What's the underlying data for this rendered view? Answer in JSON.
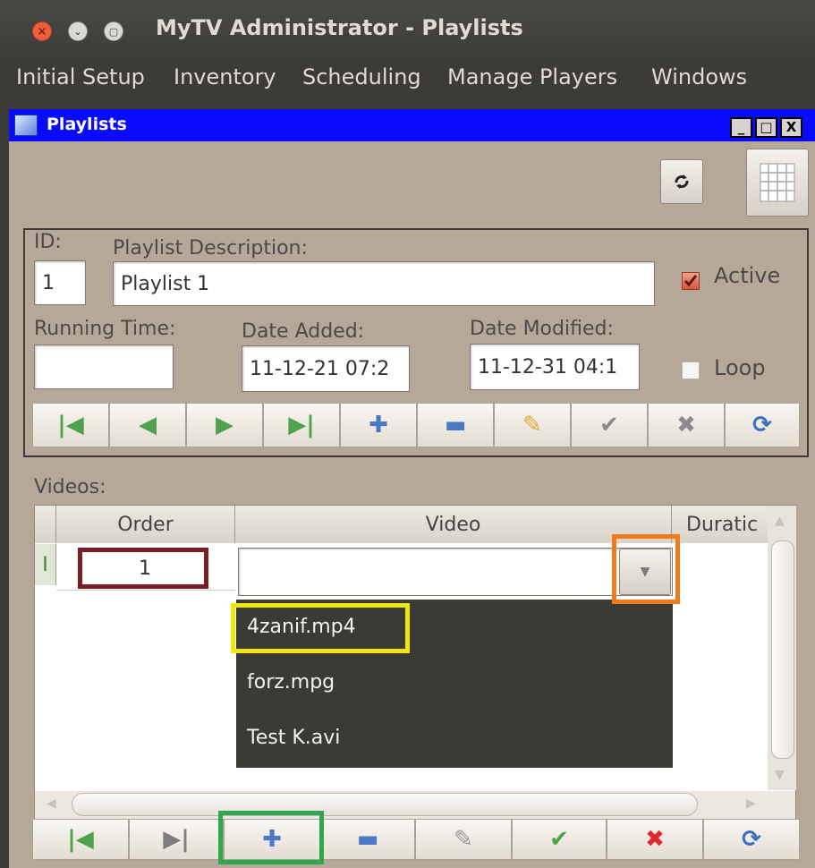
{
  "window": {
    "title": "MyTV Administrator - Playlists"
  },
  "menu": [
    "Initial Setup",
    "Inventory",
    "Scheduling",
    "Manage Players",
    "Windows"
  ],
  "frame": {
    "title": "Playlists",
    "minimize": "_",
    "maximize": "□",
    "close": "X"
  },
  "form": {
    "id_label": "ID:",
    "id_value": "1",
    "desc_label": "Playlist Description:",
    "desc_value": "Playlist 1",
    "active_label": "Active",
    "active_checked": true,
    "running_label": "Running Time:",
    "running_value": "",
    "added_label": "Date Added:",
    "added_value": "11-12-21 07:2",
    "modified_label": "Date Modified:",
    "modified_value": "11-12-31 04:1",
    "loop_label": "Loop",
    "loop_checked": false
  },
  "videos": {
    "label": "Videos:",
    "columns": [
      "Order",
      "Video",
      "Duratic"
    ],
    "rows": [
      {
        "order": "1",
        "video": ""
      }
    ],
    "dropdown_options": [
      "4zanif.mp4",
      "forz.mpg",
      "Test K.avi"
    ],
    "row_marker": "I"
  },
  "icons": {
    "first": "arrow-first",
    "prev": "arrow-prev",
    "next": "arrow-next",
    "last": "arrow-last",
    "add": "plus",
    "remove": "minus",
    "edit": "pencil",
    "post": "check",
    "cancel": "x",
    "refresh": "refresh",
    "grid": "grid",
    "reload": "reload"
  },
  "colors": {
    "title_bar": "#0a0aff",
    "highlight_order": "#7b1c24",
    "highlight_dropdown": "#f07a1e",
    "highlight_option": "#f0e60a",
    "highlight_add": "#2ea84a",
    "nav_arrow": "#4ea24c",
    "plus": "#4a79c4",
    "cancel": "#e0282c",
    "check": "#46a83e"
  }
}
